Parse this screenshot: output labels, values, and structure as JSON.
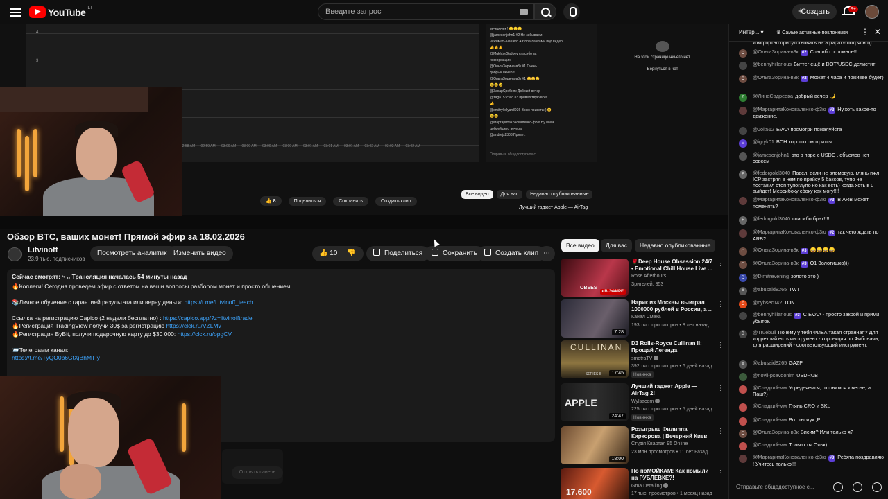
{
  "topbar": {
    "logo_text": "YouTube",
    "logo_region": "LT",
    "search_placeholder": "Введите запрос",
    "create_label": "Создать",
    "notif_count": "9+"
  },
  "embed": {
    "chart_ticks": [
      "4",
      "3"
    ],
    "axis_labels": [
      "02:58 AM",
      "02:59 AM",
      "03:00 AM",
      "03:00 AM",
      "03:00 AM",
      "03:00 AM",
      "03:01 AM",
      "03:01 AM",
      "03:01 AM",
      "03:02 AM",
      "03:02 AM",
      "03:02 AM"
    ],
    "chat_lines": [
      "вечерочек ! 🙂🙂🙂",
      "@jamesonjohn1 #2 Не забываем",
      "нажимать нашего Автора лайками под видео",
      "👍👍👍",
      "@MukhtorGadoev спасибо за",
      "информацию",
      "@ОльгаЗорина-в8к #1 Очень",
      "добрый вечер!!!",
      "@ОльгаЗорина-в8к #1 😊😊😊",
      "😊😊😊",
      "@ЗахарСребняк Добрый вечер",
      "@zaga153creo #3 приветствую всех",
      "👍",
      "@dmitrykolyan8936 Всем приветы:) 😊",
      "😊😊",
      "@МаргаритаКоноваленко-ф3ю Ну всем",
      "добрейшего вечера.",
      "@andrejs2303 Привет."
    ],
    "chat_input": "Отправьте общедоступное с...",
    "empty_text": "На этой странице ничего нет.",
    "return_text": "Вернуться в чат",
    "like_count": "8",
    "share": "Поделиться",
    "save": "Сохранить",
    "clip": "Создать клип",
    "chips": [
      "Все видео",
      "Для вас",
      "Недавно опубликованные"
    ],
    "promo": "Лучший гаджет Apple — AirTag"
  },
  "video": {
    "title": "Обзор BTC, ваших монет! Прямой эфир за 18.02.2026",
    "channel": "Litvinoff",
    "subs": "23,9 тыс. подписчиков",
    "analytics_btn": "Посмотреть аналитику",
    "edit_btn": "Изменить видео",
    "like_count": "10",
    "share_btn": "Поделиться",
    "save_btn": "Сохранить",
    "clip_btn": "Создать клип",
    "more": "⋯"
  },
  "description": {
    "line1_a": "Сейчас смотрят: ",
    "line1_b": " Трансляция началась 54 минуты назад",
    "line2": "🔥Коллеги! Сегодня проведем эфир с ответом на ваши вопросы разбором монет и просто общением.",
    "line3_a": "📚Личное обучение с гарантией результата или верну деньги: ",
    "line3_link": "https://t.me/Litvinoff_teach",
    "line4_a": "Ссылка на регистрацию Capico (2 недели бесплатно) : ",
    "line4_link": "https://capico.app/?z=litvinofftrade",
    "line5_a": "🔥Регистрация TradingView получи 30$ за регистрацию ",
    "line5_link": "https://clck.ru/VZLMv",
    "line6_a": "🔥Регистрация ByBit, получи подарочную карту до $30 000: ",
    "line6_link": "https://clck.ru/opgCV",
    "line7": "📨Телеграмм канал:",
    "line8_link": "https://t.me/+yQO0b6GtXjBhMTIy",
    "bottom_btn": "Открыть панель"
  },
  "chips": [
    "Все видео",
    "Для вас",
    "Недавно опубликованные"
  ],
  "recs": [
    {
      "title": "🌹Deep House Obsession 24/7 • Emotional Chill House Live ...",
      "channel": "Rose Afterhours",
      "meta": "Зрителей: 853",
      "badge": "",
      "dur": "",
      "live": "• В ЭФИРЕ"
    },
    {
      "title": "Нарик из Москвы выиграл 1000000 рублей в России, а ...",
      "channel": "Канал Смеха",
      "meta": "193 тыс. просмотров • 8 лет назад",
      "badge": "",
      "dur": "7:28",
      "live": ""
    },
    {
      "title": "D3 Rolls-Royce Cullinan II: Прощай Легенда",
      "channel": "smotraTV",
      "meta": "392 тыс. просмотров • 6 дней назад",
      "badge": "Новинка",
      "dur": "17:45",
      "live": ""
    },
    {
      "title": "Лучший гаджет Apple — AirTag 2!",
      "channel": "Wylsacom",
      "meta": "225 тыс. просмотров • 5 дней назад",
      "badge": "Новинка",
      "dur": "24:47",
      "live": ""
    },
    {
      "title": "Розыгрыш Филиппа Киркорова | Вечерний Киев",
      "channel": "Студiя Квартал 95 Online",
      "meta": "23 млн просмотров • 11 лет назад",
      "badge": "",
      "dur": "18:00",
      "live": ""
    },
    {
      "title": "По поМОЙКАМ: Как помыли на РУБЛЁВКЕ?!",
      "channel": "Gma Detailing",
      "meta": "17 тыс. просмотров • 1 месяц назад",
      "badge": "",
      "dur": "",
      "live": ""
    }
  ],
  "thumb_texts": {
    "cullinan": "CULLINAN",
    "apple": "APPLE",
    "obses": "OBSES",
    "series": "SERIES II",
    "num": "17.600"
  },
  "chat": {
    "tab": "Интер...",
    "filter": "Самые активные поклонники",
    "input_placeholder": "Отправьте общедоступное с...",
    "messages": [
      {
        "name": "",
        "badge": "",
        "text": "комфортно присутствовать на эфирах!! потрясно))",
        "av": ""
      },
      {
        "name": "@ОльгаЗорина-в8к",
        "badge": "#2",
        "text": "Спасибо огромное!!",
        "av": "О"
      },
      {
        "name": "@bennyhillarious",
        "badge": "",
        "text": "Биттег ещё и DOT/USDC делистит",
        "av": ""
      },
      {
        "name": "@ОльгаЗорина-в8к",
        "badge": "#2",
        "text": "Может 4 часа и поживее будет)",
        "av": "О"
      },
      {
        "name": "@ЛинаСадреева",
        "badge": "",
        "text": "добрый вечер 🌙",
        "av": "Л"
      },
      {
        "name": "@МаргаритаКоноваленко-ф3ю",
        "badge": "#2",
        "text": "Ну,хоть какое-то движение.",
        "av": ""
      },
      {
        "name": "@Jolt512",
        "badge": "",
        "text": "EVAA посмотри пожалуйста",
        "av": ""
      },
      {
        "name": "@igryk01",
        "badge": "",
        "text": "BCH хорошо смотрится",
        "av": "V"
      },
      {
        "name": "@jamesonjohn1",
        "badge": "",
        "text": "это в паре с USDC , объемов нет совсем",
        "av": ""
      },
      {
        "name": "@fedorgold3040",
        "badge": "",
        "text": "Павел, если не вломовую, глянь пжл ICP застрял в нем по прайсу 5 баксов, тупо не поставил стоп тупоглупо но как есть) когда хоть в 0 выйдет! Мерсибоку сбоку как могу!!!!",
        "av": "F"
      },
      {
        "name": "@МаргаритаКоноваленко-ф3ю",
        "badge": "#2",
        "text": "В ARB может поменять?",
        "av": ""
      },
      {
        "name": "@fedorgold3040",
        "badge": "",
        "text": "спасибо брат!!!!",
        "av": "F"
      },
      {
        "name": "@МаргаритаКоноваленко-ф3ю",
        "badge": "#2",
        "text": "так чего ждать по ARB?",
        "av": ""
      },
      {
        "name": "@ОльгаЗорина-в8к",
        "badge": "#3",
        "text": "😄😄😄😄",
        "av": "О"
      },
      {
        "name": "@ОльгаЗорина-в8к",
        "badge": "#3",
        "text": "О1 Золотишко)))",
        "av": "О"
      },
      {
        "name": "@Dimitrevening",
        "badge": "",
        "text": "золото это )",
        "av": "D"
      },
      {
        "name": "@abusaid8265",
        "badge": "",
        "text": "TWT",
        "av": "A"
      },
      {
        "name": "@cybsec142",
        "badge": "",
        "text": "TON",
        "av": "C"
      },
      {
        "name": "@bennyhillarious",
        "badge": "#3",
        "text": "С EVAA - просто закрой и прими убыток.",
        "av": ""
      },
      {
        "name": "@Truebull",
        "badge": "",
        "text": "Почему у тебя ФИБА такая странная? Для коррекций есть инструмент - коррекция по Фибоначи, для расширений - соответствующий инструмент.",
        "av": "B"
      },
      {
        "name": "@abusaid8265",
        "badge": "",
        "text": "GAZP",
        "av": "A"
      },
      {
        "name": "@novii-psevdonim",
        "badge": "",
        "text": "USDRUB",
        "av": ""
      },
      {
        "name": "@Сладкий-мм",
        "badge": "",
        "text": "Усредняемся, готовимся к весне, а Паш?)",
        "av": ""
      },
      {
        "name": "@Сладкий-мм",
        "badge": "",
        "text": "Глянь CRO и SKL",
        "av": ""
      },
      {
        "name": "@Сладкий-мм",
        "badge": "",
        "text": "Вот ты жук ;Р",
        "av": ""
      },
      {
        "name": "@ОльгаЗорина-в8к",
        "badge": "",
        "text": "Висим? Или только я?",
        "av": "О"
      },
      {
        "name": "@Сладкий-мм",
        "badge": "",
        "text": "Только ты Ольк)",
        "av": ""
      },
      {
        "name": "@МаргаритаКоноваленко-ф3ю",
        "badge": "#3",
        "text": "Ребята поздравляю ! Учитесь только!!!",
        "av": ""
      }
    ]
  },
  "colors": {
    "accent_red": "#ff0000",
    "link": "#3ea6ff",
    "badge_purple": "#5c3ed6"
  }
}
